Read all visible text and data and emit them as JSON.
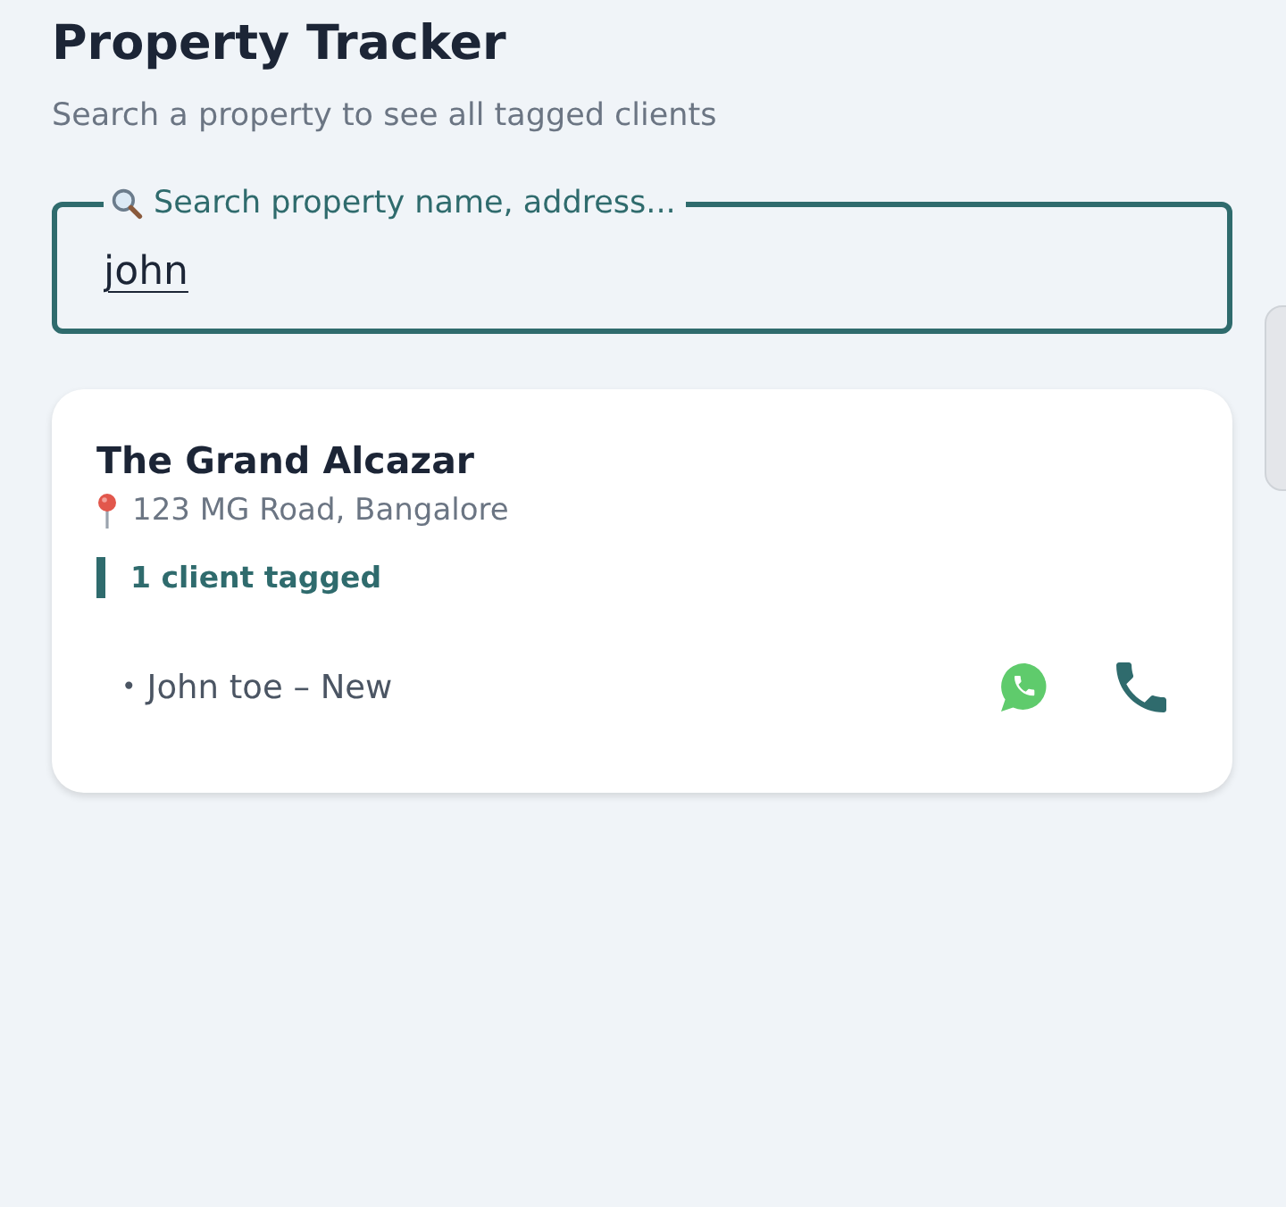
{
  "header": {
    "title": "Property Tracker",
    "subtitle": "Search a property to see all tagged clients"
  },
  "search": {
    "label": "Search property name, address...",
    "value": "john"
  },
  "results": [
    {
      "name": "The Grand Alcazar",
      "address": "123 MG Road, Bangalore",
      "tag_count": "1 client tagged",
      "clients": [
        {
          "bullet": "•",
          "label": "John toe – New",
          "actions": [
            {
              "kind": "whatsapp"
            },
            {
              "kind": "call"
            }
          ]
        }
      ]
    }
  ]
}
